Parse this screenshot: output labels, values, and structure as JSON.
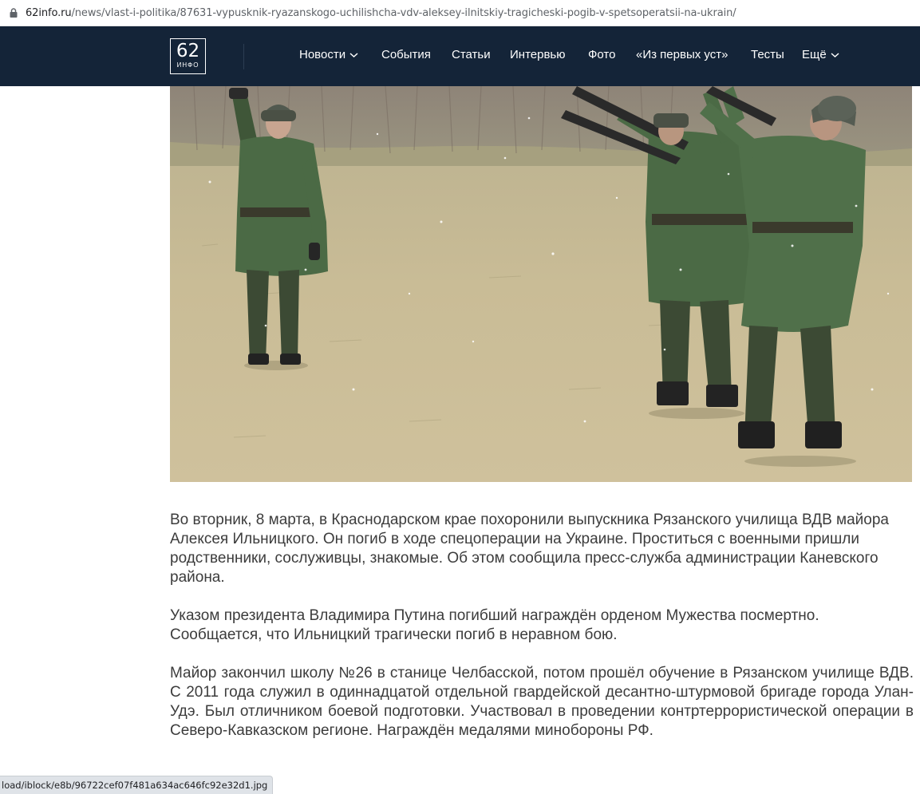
{
  "browser": {
    "url_host": "62info.ru",
    "url_path": "/news/vlast-i-politika/87631-vypusknik-ryazanskogo-uchilishcha-vdv-aleksey-ilnitskiy-tragicheski-pogib-v-spetsoperatsii-na-ukrain/",
    "status_text": "load/iblock/e8b/96722cef07f481a634ac646fc92e32d1.jpg",
    "icon": "lock-icon"
  },
  "header": {
    "logo_number": "62",
    "logo_text": "ИНФО",
    "background": "#142438",
    "nav": [
      {
        "label": "Новости",
        "dropdown": true
      },
      {
        "label": "События",
        "dropdown": false
      },
      {
        "label": "Статьи",
        "dropdown": false
      },
      {
        "label": "Интервью",
        "dropdown": false
      },
      {
        "label": "Фото",
        "dropdown": false
      },
      {
        "label": "«Из первых уст»",
        "dropdown": false
      },
      {
        "label": "Тесты",
        "dropdown": false
      },
      {
        "label": "Ещё",
        "dropdown": true
      }
    ]
  },
  "article": {
    "paragraphs": [
      "Во вторник, 8 марта, в Краснодарском крае похоронили выпускника Рязанского училища ВДВ майора Алексея Ильницкого. Он погиб в ходе спецоперации на Украине. Проститься с военными пришли родственники, сослуживцы, знакомые. Об этом сообщила пресс-служба администрации Каневского района.",
      "Указом президента Владимира Путина погибший награждён орденом Мужества посмертно. Сообщается, что Ильницкий трагически погиб в неравном бою.",
      "Майор закончил школу №26 в станице Челбасской, потом прошёл обучение в Рязанском училище ВДВ. С 2011 года служил в одиннадцатой отдельной гвардейской десантно-штурмовой бригаде города Улан-Удэ. Был отличником боевой подготовки. Участвовал в проведении контртеррористической операции в Северо-Кавказском регионе. Награждён медалями минобороны РФ."
    ]
  }
}
